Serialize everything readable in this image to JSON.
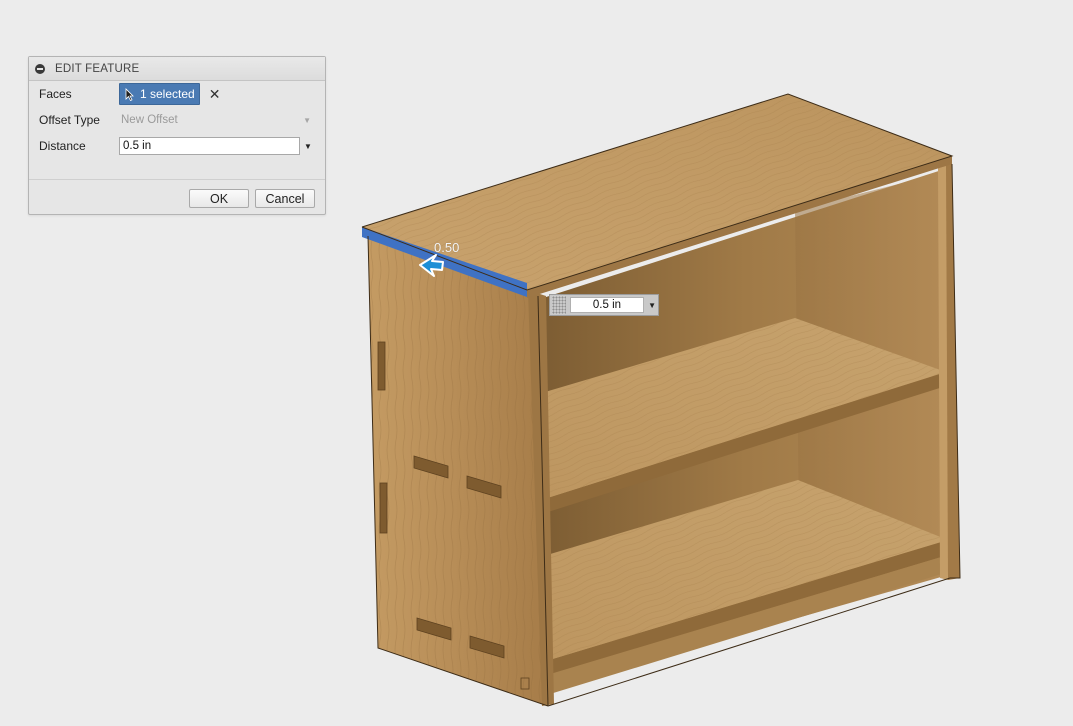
{
  "dialog": {
    "title": "EDIT FEATURE",
    "faces_label": "Faces",
    "faces_value": "1 selected",
    "offset_type_label": "Offset Type",
    "offset_type_value": "New Offset",
    "distance_label": "Distance",
    "distance_value": "0.5 in",
    "ok_label": "OK",
    "cancel_label": "Cancel"
  },
  "viewport": {
    "dimension_label": "0.50",
    "inline_distance_value": "0.5 in",
    "selected_face_color": "#3f72c4",
    "manipulator_color": "#1d8fd6"
  },
  "colors": {
    "background": "#ececec",
    "selection_button": "#4a7ab3",
    "wood_light": "#c8a06a",
    "wood_dark": "#8a6636"
  }
}
